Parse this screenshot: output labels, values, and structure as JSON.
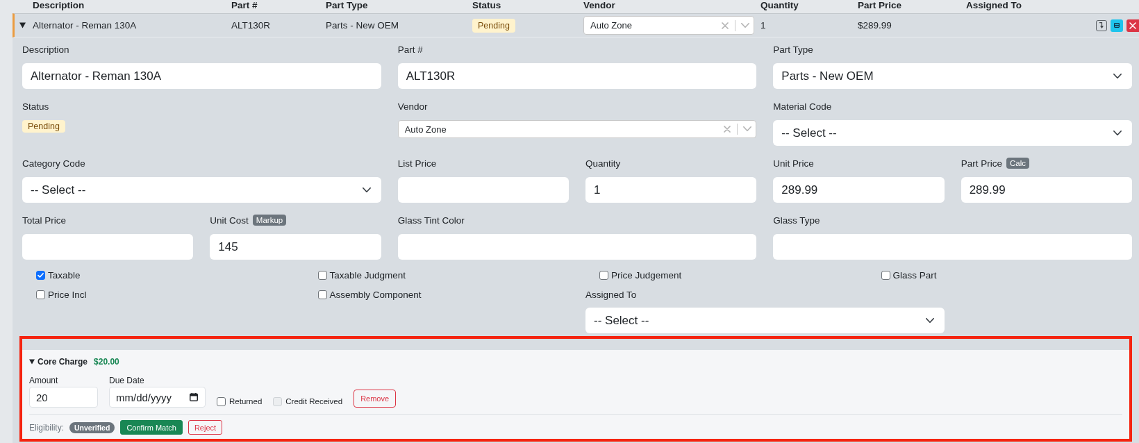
{
  "table": {
    "columns": [
      "Description",
      "Part #",
      "Part Type",
      "Status",
      "Vendor",
      "Quantity",
      "Part Price",
      "Assigned To"
    ],
    "row": {
      "selected": true,
      "expanded": true,
      "description": "Alternator - Reman 130A",
      "part_number": "ALT130R",
      "part_type": "Parts - New OEM",
      "status": "Pending",
      "vendor": "Auto Zone",
      "quantity": "1",
      "part_price": "$289.99"
    }
  },
  "details": {
    "fields": [
      {
        "kind": "text",
        "label": "Description",
        "value": "Alternator - Reman 130A"
      },
      {
        "kind": "text",
        "label": "Part #",
        "value": "ALT130R"
      },
      {
        "kind": "select",
        "label": "Part Type",
        "value": "Parts - New OEM"
      },
      {
        "kind": "badge",
        "label": "Status",
        "value": "Pending"
      },
      {
        "kind": "combo",
        "label": "Vendor",
        "value": "Auto Zone"
      },
      {
        "kind": "select",
        "label": "Material Code",
        "value": "-- Select --"
      },
      {
        "kind": "select",
        "label": "Category Code",
        "value": "-- Select --"
      },
      {
        "kind": "text",
        "label": "List Price"
      },
      {
        "kind": "text",
        "label": "Quantity",
        "value": "1"
      },
      {
        "kind": "text",
        "label": "Unit Price",
        "value": "289.99"
      },
      {
        "kind": "text",
        "label": "Part Price",
        "tag": "Calc",
        "value": "289.99"
      },
      {
        "kind": "text",
        "label": "Total Price"
      },
      {
        "kind": "text",
        "label": "Unit Cost",
        "tag": "Markup",
        "value": "145"
      },
      {
        "kind": "text",
        "label": "Glass Tint Color"
      },
      {
        "kind": "text",
        "label": "Glass Type"
      }
    ],
    "checkboxes": [
      {
        "label": "Taxable",
        "checked": true
      },
      {
        "label": "Taxable Judgment",
        "checked": false
      },
      {
        "label": "Price Judgement",
        "checked": false
      },
      {
        "label": "Glass Part",
        "checked": false
      },
      {
        "label": "Price Incl",
        "checked": false
      },
      {
        "label": "Assembly Component",
        "checked": false
      }
    ],
    "assigned_to": {
      "label": "Assigned To",
      "value": "-- Select --"
    }
  },
  "core_charge": {
    "expanded": true,
    "title": "Core Charge",
    "total": "$20.00",
    "fields": [
      {
        "kind": "text",
        "label": "Amount",
        "value": "20"
      },
      {
        "kind": "date",
        "label": "Due Date",
        "placeholder": "mm/dd/yyyy"
      }
    ],
    "checkboxes": [
      {
        "label": "Returned",
        "checked": false,
        "disabled": false
      },
      {
        "label": "Credit Received",
        "checked": false,
        "disabled": true
      }
    ],
    "remove_button": {
      "label": "Remove",
      "kind": "outline-danger"
    },
    "eligibility": {
      "label": "Eligibility:",
      "status": "Unverified",
      "buttons": [
        {
          "label": "Confirm Match",
          "kind": "success"
        },
        {
          "label": "Reject",
          "kind": "outline-danger"
        }
      ]
    }
  }
}
